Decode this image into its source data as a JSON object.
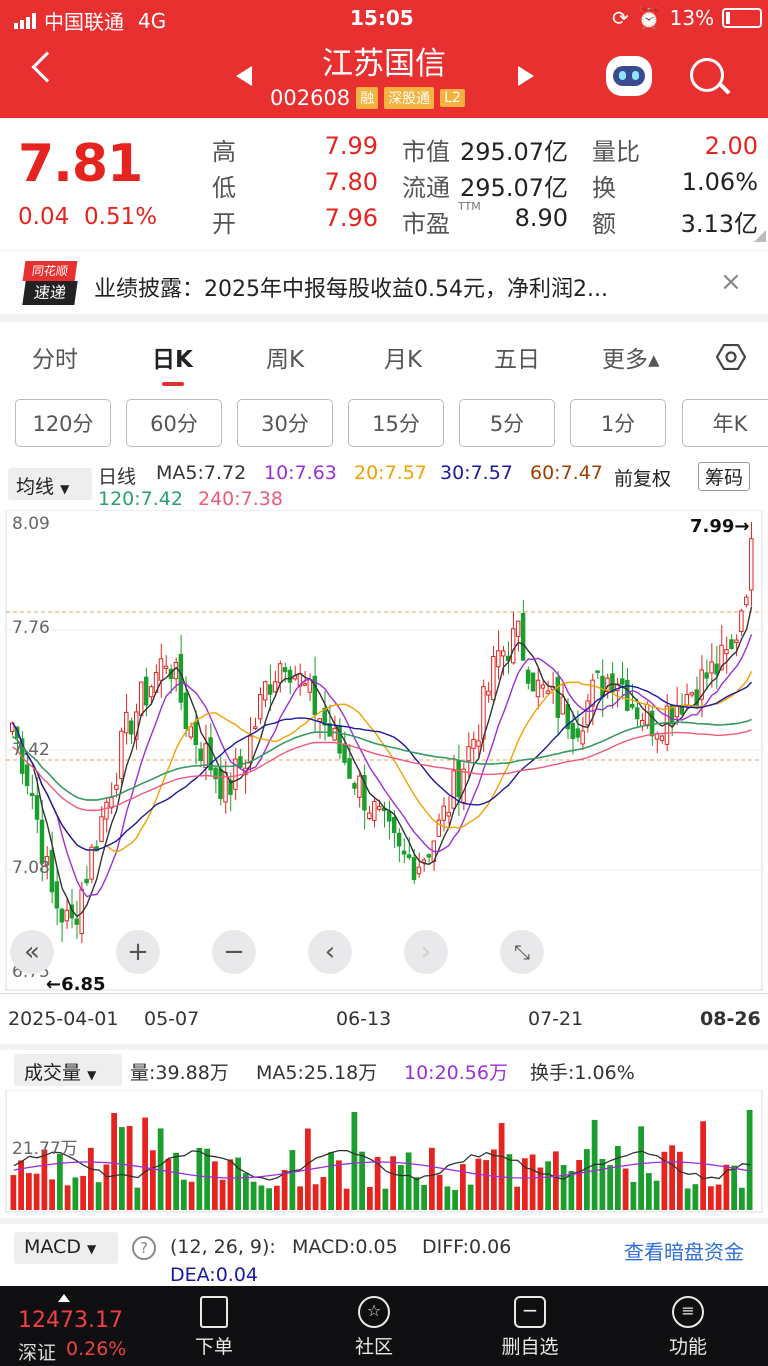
{
  "status": {
    "carrier": "中国联通",
    "network": "4G",
    "time": "15:05",
    "battery": "13%"
  },
  "header": {
    "stock_name": "江苏国信",
    "code": "002608",
    "tags": [
      "融",
      "深股通",
      "L2"
    ]
  },
  "quote": {
    "price": "7.81",
    "change": "0.04",
    "change_pct": "0.51%",
    "high_label": "高",
    "high": "7.99",
    "low_label": "低",
    "low": "7.80",
    "open_label": "开",
    "open": "7.96",
    "mcap_label": "市值",
    "mcap": "295.07亿",
    "float_label": "流通",
    "float": "295.07亿",
    "pe_label": "市盈",
    "pe_sup": "TTM",
    "pe": "8.90",
    "vr_label": "量比",
    "vr": "2.00",
    "turn_label": "换",
    "turn": "1.06%",
    "amt_label": "额",
    "amt": "3.13亿"
  },
  "news": {
    "badge_top": "同花顺",
    "badge_bottom": "速递",
    "text": "业绩披露：2025年中报每股收益0.54元，净利润2...",
    "close": "×"
  },
  "tabs": [
    "分时",
    "日K",
    "周K",
    "月K",
    "五日",
    "更多▴"
  ],
  "periods": [
    "120分",
    "60分",
    "30分",
    "15分",
    "5分",
    "1分",
    "年K"
  ],
  "ma_bar": {
    "selector": "均线",
    "kind": "日线",
    "ma5": "MA5:7.72",
    "ma10": "10:7.63",
    "ma20": "20:7.57",
    "ma30": "30:7.57",
    "ma60": "60:7.47",
    "ma120": "120:7.42",
    "ma240": "240:7.38",
    "adjust": "前复权",
    "chips": "筹码",
    "colors": {
      "ma5": "#333333",
      "ma10": "#9b30d9",
      "ma20": "#f2a100",
      "ma30": "#1a1aa0",
      "ma60": "#a04000",
      "ma120": "#2aa36a",
      "ma240": "#ef5a7a"
    }
  },
  "chart": {
    "y_labels": [
      "8.09",
      "7.76",
      "7.42",
      "7.08",
      "6.75"
    ],
    "max_label": "7.99→",
    "min_label": "←6.85",
    "dates": [
      "2025-04-01",
      "05-07",
      "06-13",
      "07-21",
      "08-26"
    ]
  },
  "volume": {
    "selector": "成交量",
    "vol": "量:39.88万",
    "ma5": "MA5:25.18万",
    "ma10": "10:20.56万",
    "turnover": "换手:1.06%",
    "axis": "21.77万"
  },
  "macd": {
    "selector": "MACD",
    "params": "(12, 26, 9):",
    "macd": "MACD:0.05",
    "diff": "DIFF:0.06",
    "dea": "DEA:0.04",
    "link": "查看暗盘资金"
  },
  "bottom": {
    "index": "12473.17",
    "index_name": "深证",
    "index_pct": "0.26%",
    "nav": [
      "下单",
      "社区",
      "删自选",
      "功能"
    ]
  }
}
